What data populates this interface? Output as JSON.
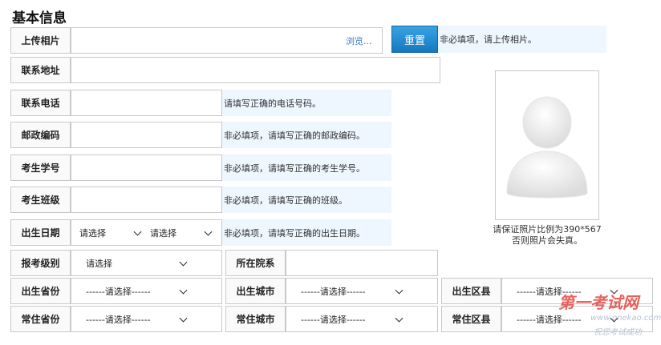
{
  "section_title": "基本信息",
  "photo_upload": {
    "label": "上传相片",
    "browse": "浏览...",
    "reset": "重置",
    "hint": "非必填项，请上传相片。"
  },
  "address": {
    "label": "联系地址"
  },
  "phone": {
    "label": "联系电话",
    "hint": "请填写正确的电话号码。"
  },
  "postcode": {
    "label": "邮政编码",
    "hint": "非必填项，请填写正确的邮政编码。"
  },
  "student_no": {
    "label": "考生学号",
    "hint": "非必填项，请填写正确的考生学号。"
  },
  "class": {
    "label": "考生班级",
    "hint": "非必填项，请填写正确的班级。"
  },
  "birth_date": {
    "label": "出生日期",
    "select1": "请选择",
    "select2": "请选择",
    "hint": "非必填项，请填写正确的出生日期。"
  },
  "exam_level": {
    "label": "报考级别",
    "value": "请选择"
  },
  "college": {
    "label": "所在院系"
  },
  "birth_province": {
    "label": "出生省份",
    "value": "------请选择------"
  },
  "birth_city": {
    "label": "出生城市",
    "value": "------请选择------"
  },
  "birth_district": {
    "label": "出生区县",
    "value": "------请选择------"
  },
  "home_province": {
    "label": "常住省份",
    "value": "------请选择------"
  },
  "home_city": {
    "label": "常住城市",
    "value": "------请选择------"
  },
  "home_district": {
    "label": "常住区县",
    "value": "------请选择------"
  },
  "photo_note": {
    "line1": "请保证照片比例为390*567",
    "line2": "否则照片会失真。"
  },
  "watermark": {
    "main": "第一考试网",
    "url": "www.onekao.com",
    "slogan": "祝您考试成功"
  }
}
